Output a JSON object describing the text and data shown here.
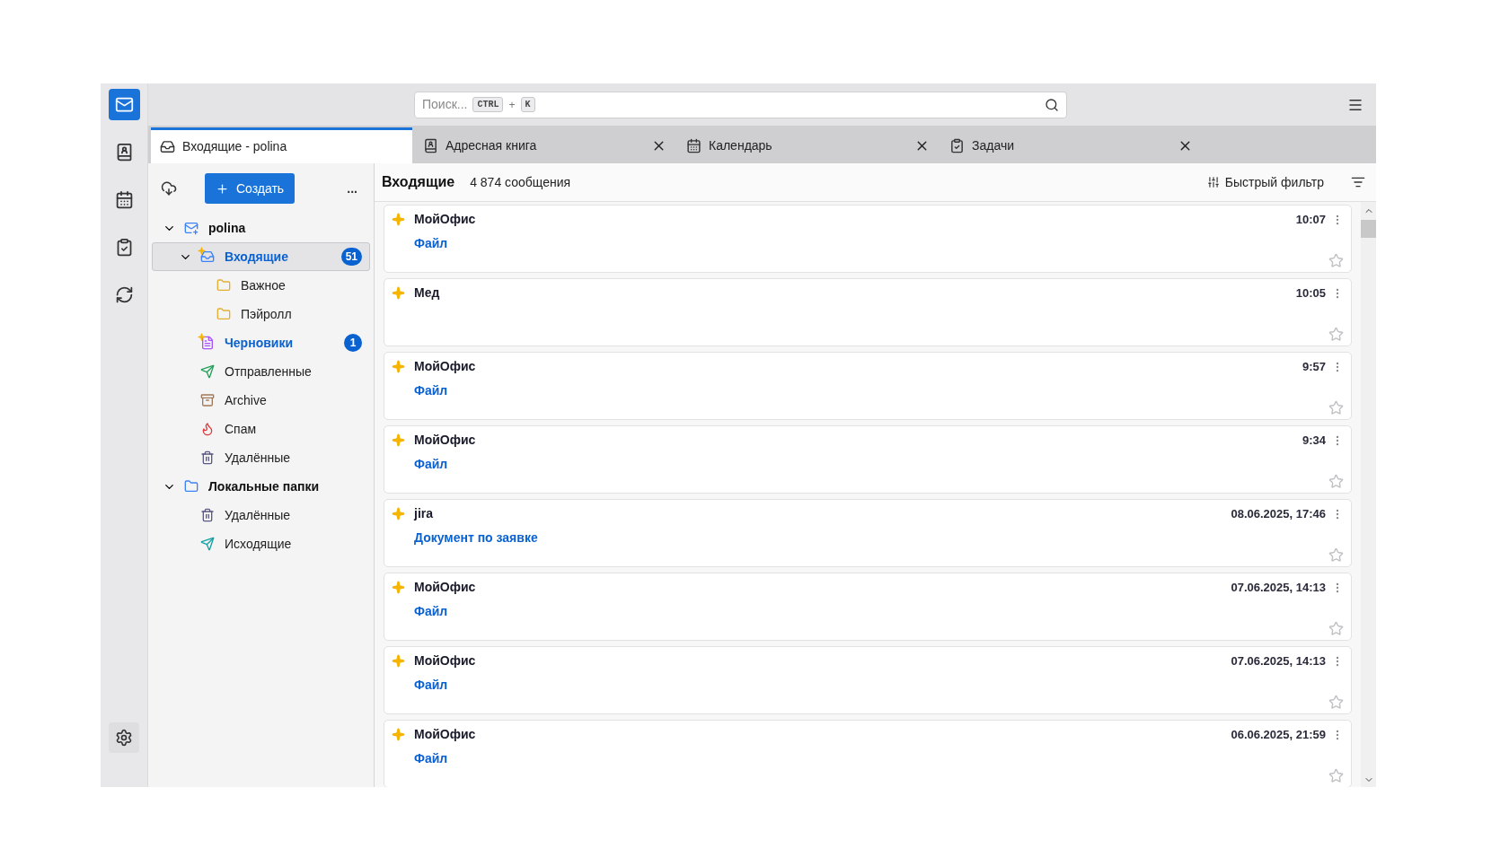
{
  "search": {
    "placeholder": "Поиск...",
    "shortcut": [
      "CTRL",
      "+",
      "K"
    ]
  },
  "tabs": [
    {
      "label": "Входящие - polina",
      "kind": "inbox",
      "selected": true,
      "closable": false
    },
    {
      "label": "Адресная книга",
      "kind": "contacts",
      "selected": false,
      "closable": true
    },
    {
      "label": "Календарь",
      "kind": "calendar",
      "selected": false,
      "closable": true
    },
    {
      "label": "Задачи",
      "kind": "tasks",
      "selected": false,
      "closable": true
    }
  ],
  "spaces": [
    {
      "kind": "mail",
      "selected": true
    },
    {
      "kind": "contacts",
      "selected": false
    },
    {
      "kind": "calendar",
      "selected": false
    },
    {
      "kind": "tasks",
      "selected": false
    },
    {
      "kind": "sync",
      "selected": false
    }
  ],
  "folder_pane": {
    "create_button": "Создать",
    "more": "...",
    "folders": [
      {
        "name": "polina",
        "kind": "account",
        "expanded": true,
        "selected": false,
        "unread": false,
        "children": [
          {
            "name": "Входящие",
            "kind": "inbox",
            "expanded": true,
            "selected": true,
            "unread": true,
            "badge": "51",
            "children": [
              {
                "name": "Важное",
                "kind": "folder",
                "selected": false,
                "unread": false
              },
              {
                "name": "Пэйролл",
                "kind": "folder",
                "selected": false,
                "unread": false
              }
            ]
          },
          {
            "name": "Черновики",
            "kind": "drafts",
            "selected": false,
            "unread": true,
            "badge": "1"
          },
          {
            "name": "Отправленные",
            "kind": "sent",
            "selected": false,
            "unread": false
          },
          {
            "name": "Archive",
            "kind": "archive",
            "selected": false,
            "unread": false
          },
          {
            "name": "Спам",
            "kind": "spam",
            "selected": false,
            "unread": false
          },
          {
            "name": "Удалённые",
            "kind": "trash",
            "selected": false,
            "unread": false
          }
        ]
      },
      {
        "name": "Локальные папки",
        "kind": "local",
        "expanded": true,
        "selected": false,
        "unread": false,
        "children": [
          {
            "name": "Удалённые",
            "kind": "trash",
            "selected": false,
            "unread": false
          },
          {
            "name": "Исходящие",
            "kind": "outbox",
            "selected": false,
            "unread": false
          }
        ]
      }
    ]
  },
  "message_list": {
    "title": "Входящие",
    "count": "4 874 сообщения",
    "quick_filter": "Быстрый фильтр",
    "messages": [
      {
        "sender": "МойОфис",
        "subject": "Файл",
        "time": "10:07",
        "new": true,
        "starred": false
      },
      {
        "sender": "Мед",
        "time": "10:05",
        "new": true,
        "starred": false
      },
      {
        "sender": "МойОфис",
        "subject": "Файл",
        "time": "9:57",
        "new": true,
        "starred": false
      },
      {
        "sender": "МойОфис",
        "subject": "Файл",
        "time": "9:34",
        "new": true,
        "starred": false
      },
      {
        "sender": "jira",
        "subject": "Документ по заявке",
        "time": "08.06.2025, 17:46",
        "new": true,
        "starred": false
      },
      {
        "sender": "МойОфис",
        "subject": "Файл",
        "time": "07.06.2025, 14:13",
        "new": true,
        "starred": false
      },
      {
        "sender": "МойОфис",
        "subject": "Файл",
        "time": "07.06.2025, 14:13",
        "new": true,
        "starred": false
      },
      {
        "sender": "МойОфис",
        "subject": "Файл",
        "time": "06.06.2025, 21:59",
        "new": true,
        "starred": false
      }
    ]
  }
}
